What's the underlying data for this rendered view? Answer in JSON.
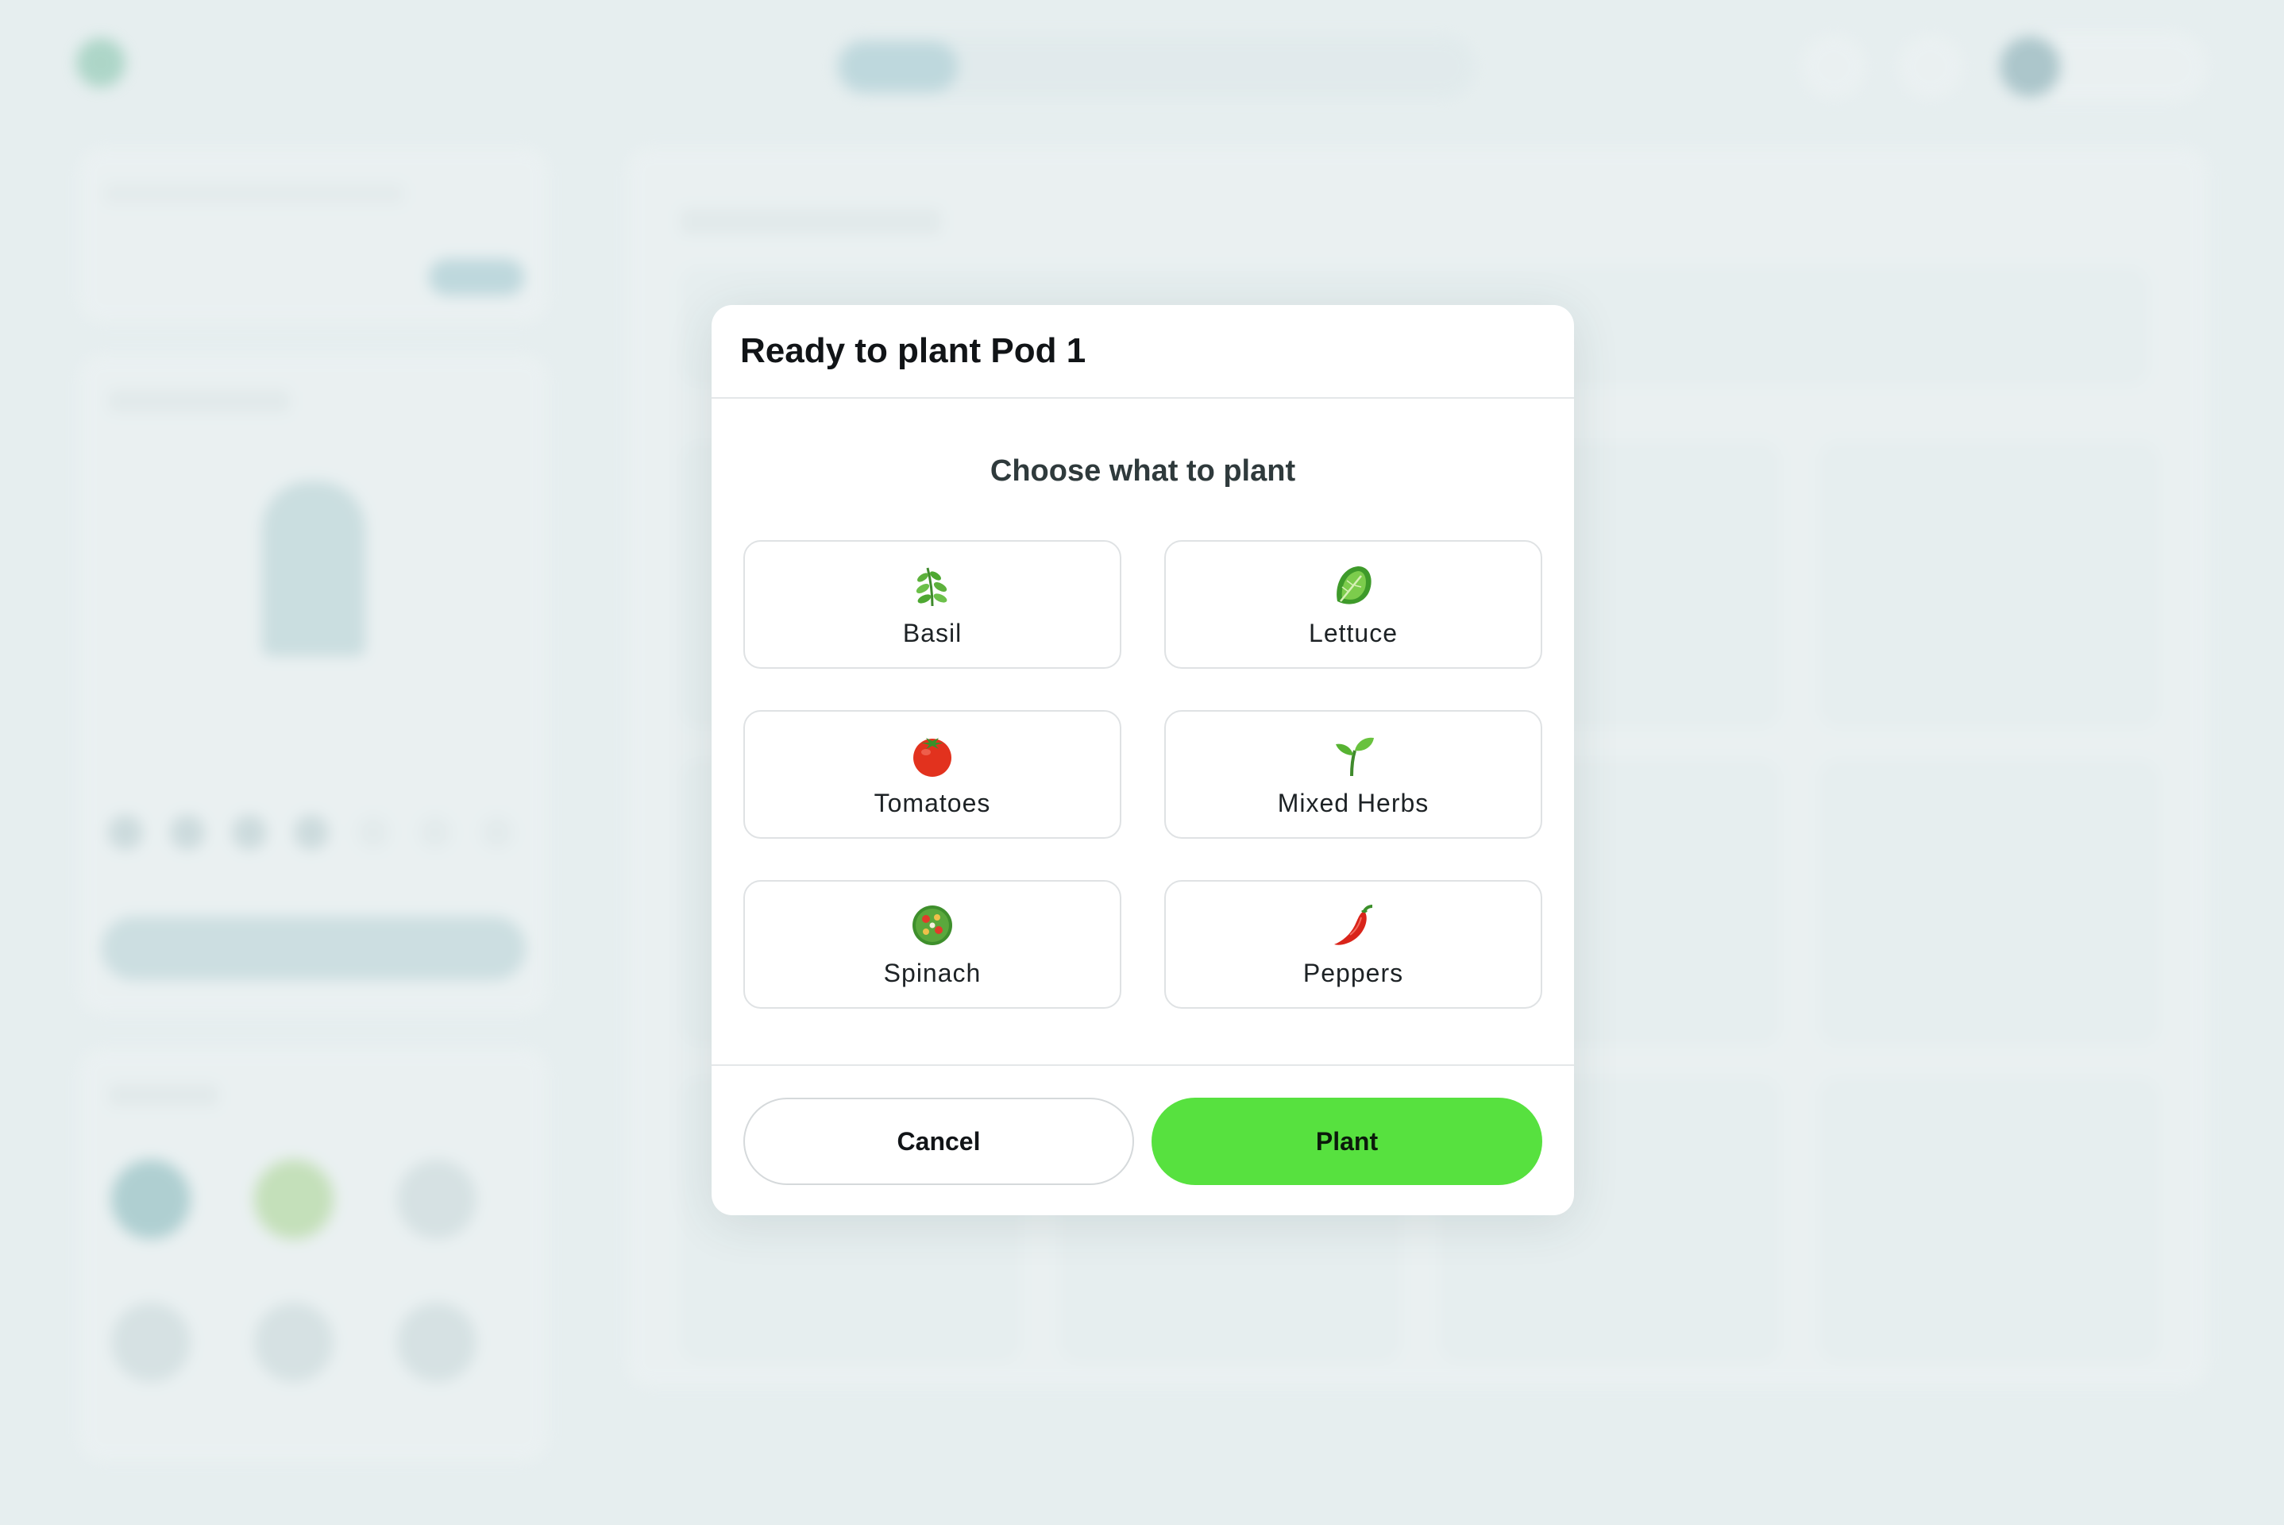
{
  "modal": {
    "title": "Ready to plant Pod 1",
    "subtitle": "Choose what to plant",
    "options": [
      {
        "label": "Basil",
        "icon": "herb-icon"
      },
      {
        "label": "Lettuce",
        "icon": "lettuce-icon"
      },
      {
        "label": "Tomatoes",
        "icon": "tomato-icon"
      },
      {
        "label": "Mixed Herbs",
        "icon": "seedling-icon"
      },
      {
        "label": "Spinach",
        "icon": "salad-icon"
      },
      {
        "label": "Peppers",
        "icon": "chili-pepper-icon"
      }
    ],
    "cancel_label": "Cancel",
    "plant_label": "Plant"
  },
  "colors": {
    "accent_green": "#57e13f",
    "overlay_bg": "#e6eeef",
    "modal_bg": "#ffffff"
  }
}
